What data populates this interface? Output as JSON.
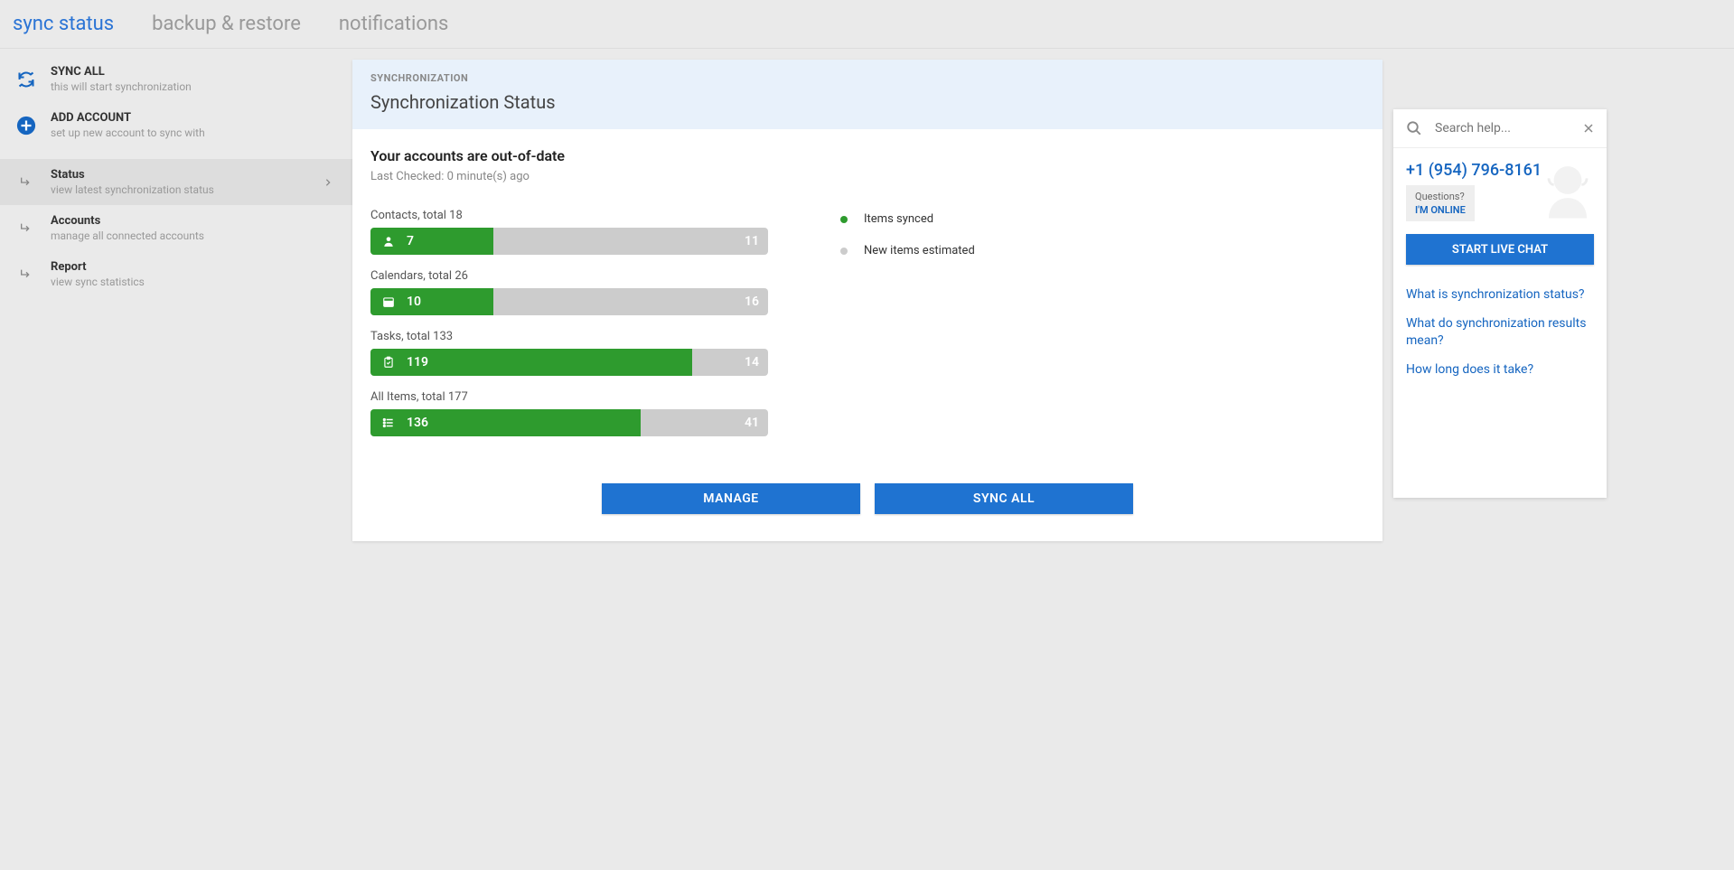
{
  "tabs": {
    "sync": "sync status",
    "backup": "backup & restore",
    "notifications": "notifications"
  },
  "sidebar": {
    "sync_all": {
      "title": "SYNC ALL",
      "sub": "this will start synchronization"
    },
    "add_account": {
      "title": "ADD ACCOUNT",
      "sub": "set up new account to sync with"
    },
    "status": {
      "title": "Status",
      "sub": "view latest synchronization status"
    },
    "accounts": {
      "title": "Accounts",
      "sub": "manage all connected accounts"
    },
    "report": {
      "title": "Report",
      "sub": "view sync statistics"
    }
  },
  "card": {
    "sup": "SYNCHRONIZATION",
    "title": "Synchronization Status",
    "status_title": "Your accounts are out-of-date",
    "status_sub": "Last Checked: 0 minute(s) ago"
  },
  "chart_data": {
    "type": "bar",
    "series": [
      {
        "name": "Contacts",
        "total": 18,
        "synced": 7,
        "new": 11
      },
      {
        "name": "Calendars",
        "total": 26,
        "synced": 10,
        "new": 16
      },
      {
        "name": "Tasks",
        "total": 133,
        "synced": 119,
        "new": 14
      },
      {
        "name": "All Items",
        "total": 177,
        "synced": 136,
        "new": 41
      }
    ],
    "legend": {
      "synced": "Items synced",
      "new": "New items estimated"
    }
  },
  "bar_labels": {
    "contacts": "Contacts, total 18",
    "calendars": "Calendars, total 26",
    "tasks": "Tasks, total 133",
    "all": "All Items, total 177"
  },
  "bar_values": {
    "contacts_synced": "7",
    "contacts_new": "11",
    "calendars_synced": "10",
    "calendars_new": "16",
    "tasks_synced": "119",
    "tasks_new": "14",
    "all_synced": "136",
    "all_new": "41"
  },
  "buttons": {
    "manage": "MANAGE",
    "sync_all": "SYNC ALL"
  },
  "help": {
    "search_placeholder": "Search help...",
    "phone": "+1 (954) 796-8161",
    "questions": "Questions?",
    "online": "I'M ONLINE",
    "live_chat": "START LIVE CHAT",
    "links": {
      "l1": "What is synchronization status?",
      "l2": "What do synchronization results mean?",
      "l3": "How long does it take?"
    }
  }
}
